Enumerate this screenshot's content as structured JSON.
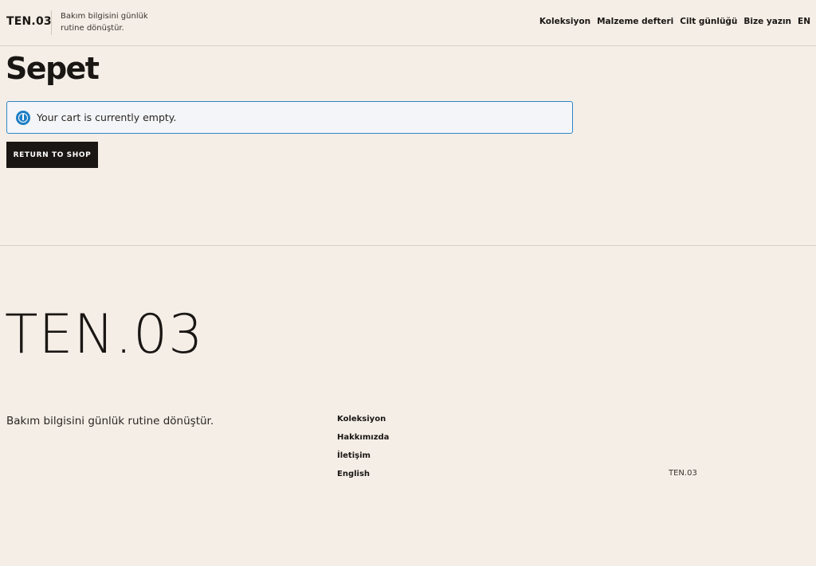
{
  "header": {
    "brand": "TEN.03",
    "tagline": "Bakım bilgisini günlük rutine dönüştür.",
    "nav": [
      {
        "label": "Koleksiyon"
      },
      {
        "label": "Malzeme defteri"
      },
      {
        "label": "Cilt günlüğü"
      },
      {
        "label": "Bize yazın"
      },
      {
        "label": "EN"
      }
    ]
  },
  "main": {
    "title": "Sepet",
    "notice": {
      "icon": "info-icon",
      "text": "Your cart is currently empty.",
      "border_color": "#2f86c6"
    },
    "return_button": "RETURN TO SHOP"
  },
  "footer": {
    "logo": "TEN.03",
    "tagline": "Bakım bilgisini günlük rutine dönüştür.",
    "links": [
      {
        "label": "Koleksiyon"
      },
      {
        "label": "Hakkımızda"
      },
      {
        "label": "İletişim"
      },
      {
        "label": "English"
      }
    ],
    "mark": "TEN.03"
  },
  "colors": {
    "background": "#f4eee7",
    "text": "#1a1613",
    "button_bg": "#1a1613",
    "info_accent": "#1e7fc4"
  }
}
